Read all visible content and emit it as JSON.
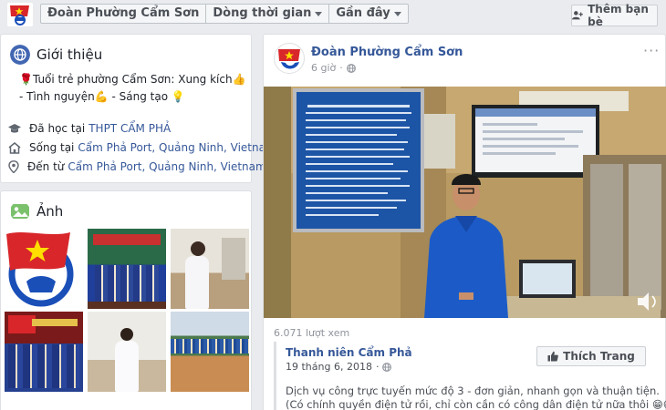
{
  "header": {
    "crumbs": [
      {
        "label": "Đoàn Phường Cẩm Sơn",
        "has_caret": false
      },
      {
        "label": "Dòng thời gian",
        "has_caret": true
      },
      {
        "label": "Gần đây",
        "has_caret": true
      }
    ],
    "add_friend_label": "Thêm bạn bè"
  },
  "intro": {
    "title": "Giới thiệu",
    "bio": "🌹Tuổi trẻ phường Cẩm Sơn: Xung kích👍 - Tình nguyện💪 - Sáng tạo 💡",
    "studied_prefix": "Đã học tại",
    "studied_link": "THPT CẨM PHẢ",
    "lives_prefix": "Sống tại",
    "lives_link": "Cẩm Phả Port, Quảng Ninh, Vietnam",
    "from_prefix": "Đến từ",
    "from_link": "Cẩm Phả Port, Quảng Ninh, Vietnam"
  },
  "photos": {
    "title": "Ảnh"
  },
  "post": {
    "page_name": "Đoàn Phường Cẩm Sơn",
    "time": "6 giờ",
    "more": "···",
    "views": "6.071 lượt xem",
    "shared": {
      "name": "Thanh niên Cẩm Phả",
      "date": "19 tháng 6, 2018",
      "like_label": "Thích Trang",
      "line1": "Dịch vụ công trực tuyến mức độ 3 - đơn giản, nhanh gọn và thuận tiện.",
      "line2": "(Có chính quyền điện tử rồi, chỉ còn cần có công dân điện tử nữa thôi 😁😁😁)"
    }
  },
  "colors": {
    "link": "#365899",
    "youth_blue": "#1a4fb8",
    "flag_red": "#d8262a",
    "star_yellow": "#ffde00"
  }
}
